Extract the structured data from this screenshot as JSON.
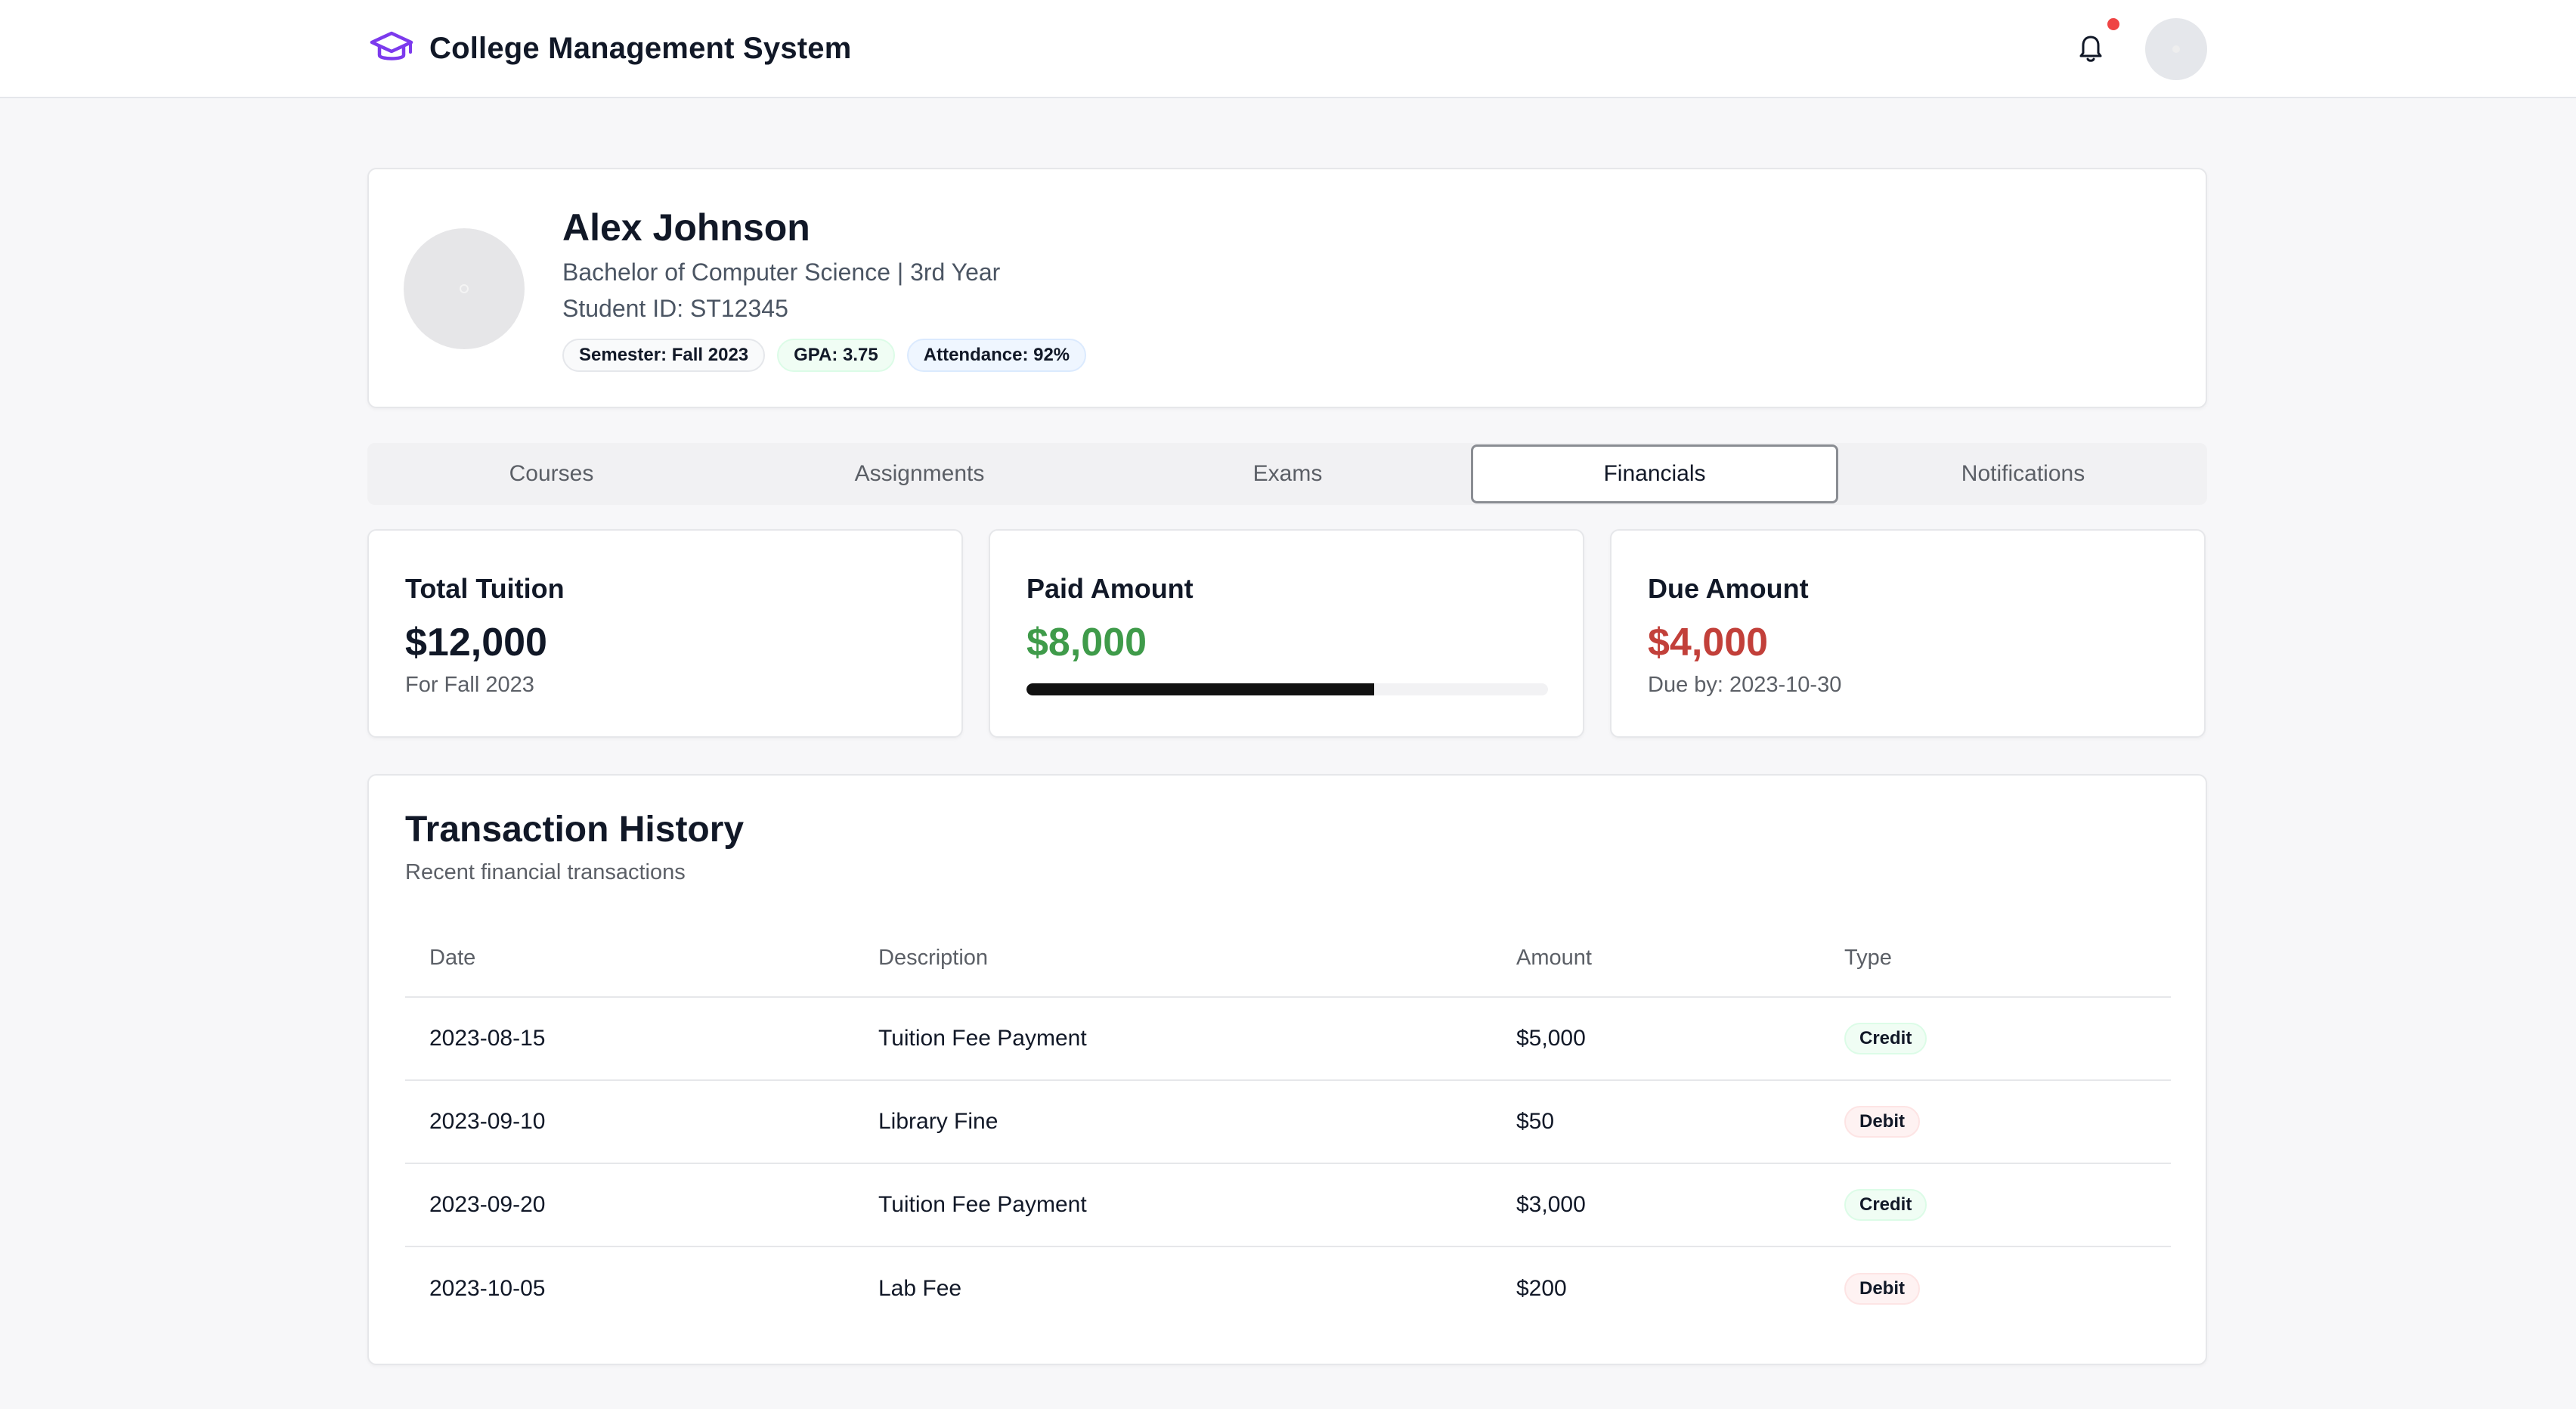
{
  "app": {
    "title": "College Management System",
    "accent_color": "#7c3aed",
    "brand_icon": "graduation-cap-icon",
    "notification_icon": "bell-icon"
  },
  "profile": {
    "name": "Alex Johnson",
    "program": "Bachelor of Computer Science | 3rd Year",
    "student_id": "Student ID: ST12345",
    "badges": {
      "semester": "Semester: Fall 2023",
      "gpa": "GPA: 3.75",
      "attendance": "Attendance: 92%"
    }
  },
  "tabs": [
    {
      "label": "Courses"
    },
    {
      "label": "Assignments"
    },
    {
      "label": "Exams"
    },
    {
      "label": "Financials",
      "active": true
    },
    {
      "label": "Notifications"
    }
  ],
  "financials": {
    "total": {
      "title": "Total Tuition",
      "value": "$12,000",
      "sub": "For Fall 2023"
    },
    "paid": {
      "title": "Paid Amount",
      "value": "$8,000",
      "color": "#3f9b4a",
      "progress_percent": 66.7
    },
    "due": {
      "title": "Due Amount",
      "value": "$4,000",
      "color": "#c2403a",
      "sub": "Due by: 2023-10-30"
    }
  },
  "history": {
    "title": "Transaction History",
    "subtitle": "Recent financial transactions",
    "columns": [
      "Date",
      "Description",
      "Amount",
      "Type"
    ],
    "rows": [
      {
        "date": "2023-08-15",
        "description": "Tuition Fee Payment",
        "amount": "$5,000",
        "type": "Credit"
      },
      {
        "date": "2023-09-10",
        "description": "Library Fine",
        "amount": "$50",
        "type": "Debit"
      },
      {
        "date": "2023-09-20",
        "description": "Tuition Fee Payment",
        "amount": "$3,000",
        "type": "Credit"
      },
      {
        "date": "2023-10-05",
        "description": "Lab Fee",
        "amount": "$200",
        "type": "Debit"
      }
    ]
  }
}
